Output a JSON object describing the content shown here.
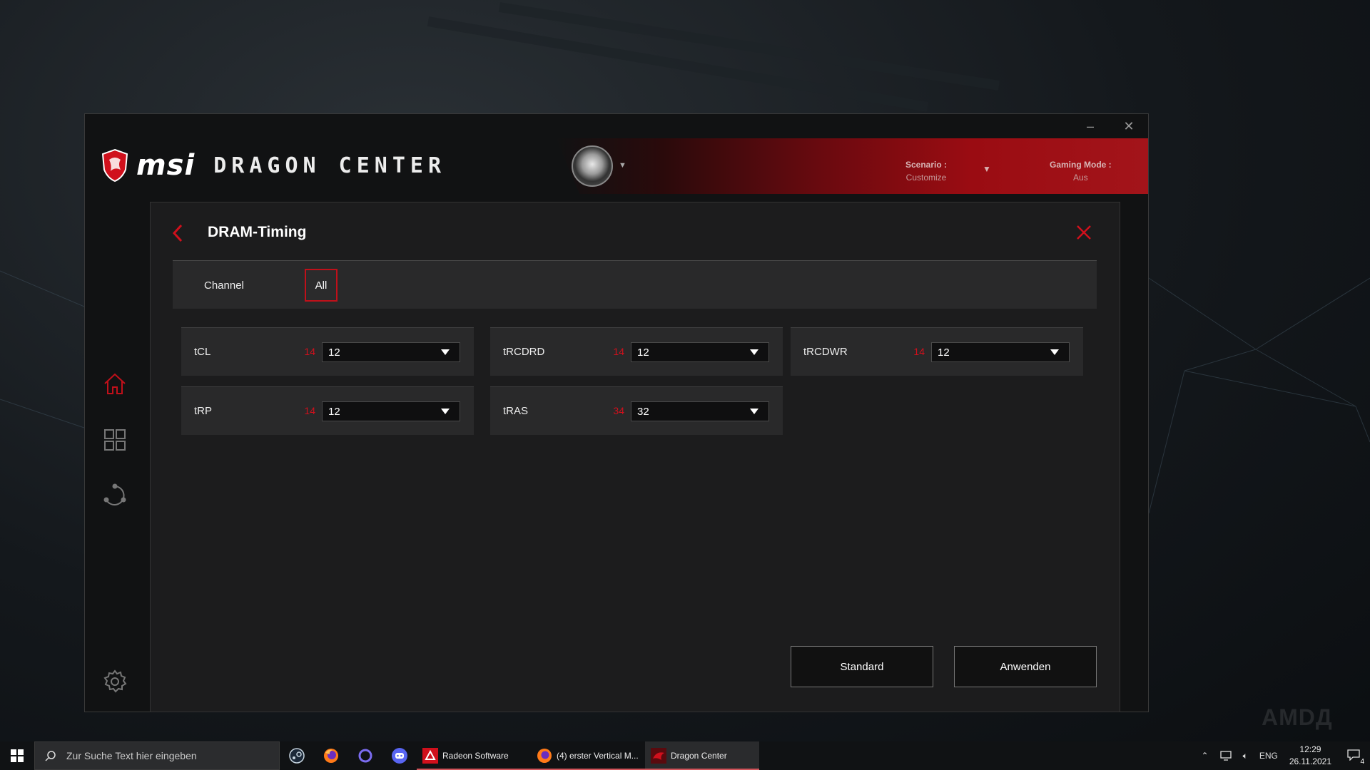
{
  "app": {
    "brand": "msi",
    "product": "DRAGON CENTER",
    "window_controls": {
      "minimize": "–",
      "close": "✕"
    },
    "scenario": {
      "label": "Scenario :",
      "value": "Customize"
    },
    "gaming_mode": {
      "label": "Gaming Mode :",
      "value": "Aus"
    },
    "sidebar": [
      "home-icon",
      "apps-grid-icon",
      "network-icon",
      "settings-icon"
    ]
  },
  "panel": {
    "title": "DRAM-Timing",
    "channel_label": "Channel",
    "channel_value": "All",
    "timings": [
      {
        "name": "tCL",
        "default": "14",
        "value": "12"
      },
      {
        "name": "tRCDRD",
        "default": "14",
        "value": "12"
      },
      {
        "name": "tRCDWR",
        "default": "14",
        "value": "12"
      },
      {
        "name": "tRP",
        "default": "14",
        "value": "12"
      },
      {
        "name": "tRAS",
        "default": "34",
        "value": "32"
      }
    ],
    "buttons": {
      "standard": "Standard",
      "apply": "Anwenden"
    }
  },
  "colors": {
    "accent": "#d0101c",
    "panel": "#1c1c1d",
    "card": "#29292a"
  },
  "taskbar": {
    "search_placeholder": "Zur Suche Text hier eingeben",
    "pinned": [
      "steam-icon",
      "firefox-icon",
      "cortana-icon",
      "discord-icon"
    ],
    "apps": [
      {
        "label": "Radeon Software",
        "active": false
      },
      {
        "label": "(4) erster Vertical M...",
        "active": false
      },
      {
        "label": "Dragon Center",
        "active": true
      }
    ],
    "language": "ENG",
    "time": "12:29",
    "date": "26.11.2021",
    "notification_count": "4"
  },
  "watermark": "AMDД"
}
